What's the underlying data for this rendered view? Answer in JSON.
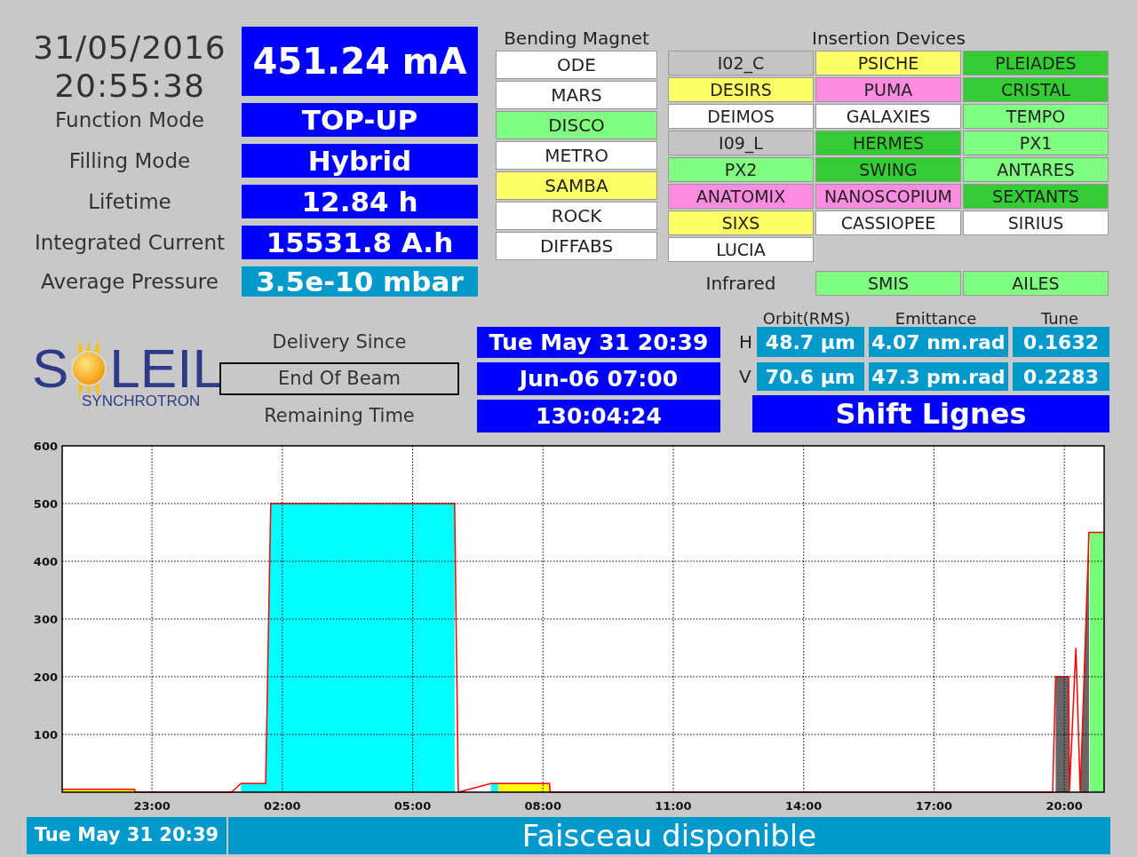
{
  "clock": {
    "date": "31/05/2016",
    "time": "20:55:38"
  },
  "beam_current": {
    "value": "451.24 mA",
    "color": "#0000ff"
  },
  "parameters": [
    {
      "label": "Function Mode",
      "value": "TOP-UP",
      "color": "#0000ff"
    },
    {
      "label": "Filling Mode",
      "value": "Hybrid",
      "color": "#0000ff"
    },
    {
      "label": "Lifetime",
      "value": "12.84 h",
      "color": "#0000ff"
    },
    {
      "label": "Integrated Current",
      "value": "15531.8 A.h",
      "color": "#0000ff"
    },
    {
      "label": "Average Pressure",
      "value": "3.5e-10 mbar",
      "color": "#0099cc"
    }
  ],
  "bending_magnet": {
    "title": "Bending Magnet",
    "beamlines": [
      {
        "name": "ODE",
        "color": "#ffffff"
      },
      {
        "name": "MARS",
        "color": "#ffffff"
      },
      {
        "name": "DISCO",
        "color": "#80ff80"
      },
      {
        "name": "METRO",
        "color": "#ffffff"
      },
      {
        "name": "SAMBA",
        "color": "#ffff66"
      },
      {
        "name": "ROCK",
        "color": "#ffffff"
      },
      {
        "name": "DIFFABS",
        "color": "#ffffff"
      }
    ]
  },
  "insertion_devices": {
    "title": "Insertion Devices",
    "beamlines": [
      {
        "name": "I02_C",
        "color": "#c4c4c4"
      },
      {
        "name": "PSICHE",
        "color": "#ffff66"
      },
      {
        "name": "PLEIADES",
        "color": "#33cc33"
      },
      {
        "name": "DESIRS",
        "color": "#ffff66"
      },
      {
        "name": "PUMA",
        "color": "#ff8ce0"
      },
      {
        "name": "CRISTAL",
        "color": "#33cc33"
      },
      {
        "name": "DEIMOS",
        "color": "#ffffff"
      },
      {
        "name": "GALAXIES",
        "color": "#ffffff"
      },
      {
        "name": "TEMPO",
        "color": "#80ff80"
      },
      {
        "name": "I09_L",
        "color": "#c4c4c4"
      },
      {
        "name": "HERMES",
        "color": "#33cc33"
      },
      {
        "name": "PX1",
        "color": "#80ff80"
      },
      {
        "name": "PX2",
        "color": "#80ff80"
      },
      {
        "name": "SWING",
        "color": "#33cc33"
      },
      {
        "name": "ANTARES",
        "color": "#80ff80"
      },
      {
        "name": "ANATOMIX",
        "color": "#ff8ce0"
      },
      {
        "name": "NANOSCOPIUM",
        "color": "#ff8ce0"
      },
      {
        "name": "SEXTANTS",
        "color": "#33cc33"
      },
      {
        "name": "SIXS",
        "color": "#ffff66"
      },
      {
        "name": "CASSIOPEE",
        "color": "#ffffff"
      },
      {
        "name": "SIRIUS",
        "color": "#ffffff"
      },
      {
        "name": "LUCIA",
        "color": "#ffffff"
      }
    ]
  },
  "infrared": {
    "title": "Infrared",
    "beamlines": [
      {
        "name": "SMIS",
        "color": "#80ff80"
      },
      {
        "name": "AILES",
        "color": "#80ff80"
      }
    ]
  },
  "logo": {
    "wordmark_start": "S",
    "wordmark_end": "LEIL",
    "tagline": "SYNCHROTRON"
  },
  "delivery": [
    {
      "label": "Delivery Since",
      "framed": false,
      "value": "Tue May 31 20:39"
    },
    {
      "label": "End Of Beam",
      "framed": true,
      "value": "Jun-06 07:00"
    },
    {
      "label": "Remaining Time",
      "framed": false,
      "value": "130:04:24"
    }
  ],
  "beam_parameters": {
    "columns": [
      "Orbit(RMS)",
      "Emittance",
      "Tune"
    ],
    "rows": [
      {
        "plane": "H",
        "values": [
          "48.7 µm",
          "4.07 nm.rad",
          "0.1632"
        ]
      },
      {
        "plane": "V",
        "values": [
          "70.6 µm",
          "47.3 pm.rad",
          "0.2283"
        ]
      }
    ]
  },
  "shift": {
    "value": "Shift Lignes"
  },
  "chart": {
    "chart_data": {
      "type": "area",
      "x": [
        "2016-05-30T20:56",
        "2016-05-30T22:36",
        "2016-05-30T22:37",
        "2016-05-31T00:50",
        "2016-05-31T01:03",
        "2016-05-31T01:37",
        "2016-05-31T01:44",
        "2016-05-31T05:58",
        "2016-05-31T06:03",
        "2016-05-31T06:48",
        "2016-05-31T06:58",
        "2016-05-31T08:09",
        "2016-05-31T08:10",
        "2016-05-31T19:44",
        "2016-05-31T19:48",
        "2016-05-31T20:06",
        "2016-05-31T20:07",
        "2016-05-31T20:16",
        "2016-05-31T20:22",
        "2016-05-31T20:34",
        "2016-05-31T20:35",
        "2016-05-31T20:55"
      ],
      "series": [
        {
          "type": "area",
          "color": "#ffff00",
          "values": [
            5,
            5,
            null,
            null,
            null,
            null,
            null,
            null,
            null,
            null,
            15,
            15,
            null,
            null,
            null,
            null,
            null,
            null,
            null,
            null,
            null,
            null
          ]
        },
        {
          "type": "area",
          "color": "#00ffff",
          "values": [
            null,
            null,
            null,
            null,
            15,
            15,
            500,
            500,
            null,
            15,
            15,
            null,
            null,
            null,
            null,
            null,
            null,
            null,
            null,
            null,
            null,
            null
          ]
        },
        {
          "type": "area",
          "color": "#666666",
          "values": [
            null,
            null,
            null,
            null,
            null,
            null,
            null,
            null,
            null,
            null,
            null,
            null,
            null,
            null,
            200,
            200,
            null,
            null,
            0,
            450,
            null,
            null
          ]
        },
        {
          "type": "area",
          "color": "#77ff77",
          "values": [
            null,
            null,
            null,
            null,
            null,
            null,
            null,
            null,
            null,
            null,
            null,
            null,
            null,
            null,
            null,
            null,
            null,
            null,
            null,
            null,
            450,
            450
          ]
        },
        {
          "type": "line",
          "color": "#ff0000",
          "values": [
            5,
            5,
            0,
            0,
            15,
            15,
            500,
            500,
            0,
            15,
            15,
            15,
            0,
            0,
            200,
            200,
            0,
            250,
            0,
            450,
            450,
            450
          ]
        }
      ],
      "grid": true,
      "xlim": [
        "2016-05-30T20:56",
        "2016-05-31T20:55"
      ],
      "ylim": [
        0,
        600
      ],
      "xticks": [
        {
          "value": "2016-05-30T23:00",
          "label": "23:00"
        },
        {
          "value": "2016-05-31T02:00",
          "label": "02:00"
        },
        {
          "value": "2016-05-31T05:00",
          "label": "05:00"
        },
        {
          "value": "2016-05-31T08:00",
          "label": "08:00"
        },
        {
          "value": "2016-05-31T11:00",
          "label": "11:00"
        },
        {
          "value": "2016-05-31T14:00",
          "label": "14:00"
        },
        {
          "value": "2016-05-31T17:00",
          "label": "17:00"
        },
        {
          "value": "2016-05-31T20:00",
          "label": "20:00"
        }
      ],
      "yticks": [
        100,
        200,
        300,
        400,
        500,
        600
      ]
    }
  },
  "footer": {
    "time": "Tue May 31 20:39",
    "message": "Faisceau disponible"
  }
}
